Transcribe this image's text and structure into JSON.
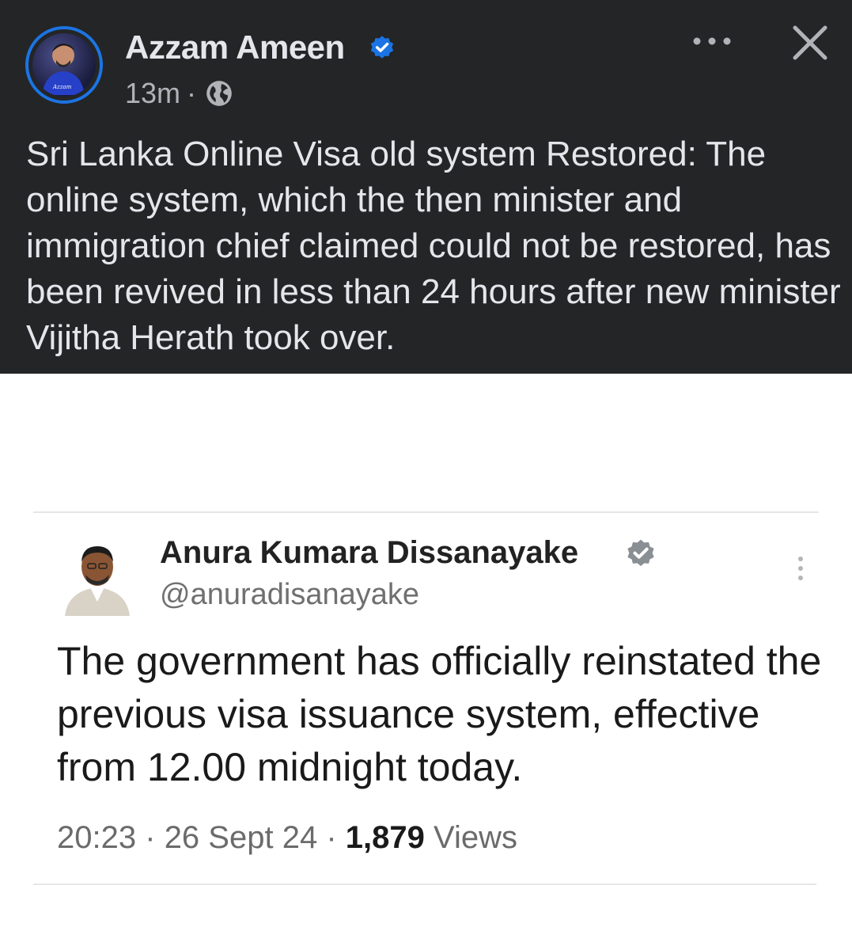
{
  "post": {
    "author": "Azzam Ameen",
    "time": "13m",
    "separator": "·",
    "text": "Sri Lanka Online Visa old system Restored: The online system, which the then minister and immigration chief claimed could not be restored, has been revived in less than 24 hours after new minister Vijitha Herath took over.",
    "icons": {
      "verified": "verified-badge-icon",
      "audience": "globe-icon",
      "more": "more-horizontal-icon",
      "close": "close-icon"
    },
    "colors": {
      "background": "#242526",
      "text": "#e4e6eb",
      "accent": "#1b74e4"
    }
  },
  "tweet": {
    "name": "Anura Kumara Dissanayake",
    "handle": "@anuradisanayake",
    "text": "The government has officially reinstated the previous visa issuance system, effective from 12.00 midnight today.",
    "time": "20:23",
    "date": "26 Sept 24",
    "separator": "·",
    "views_count": "1,879",
    "views_label": "Views",
    "icons": {
      "verified": "verified-badge-icon",
      "more": "more-vertical-icon"
    }
  }
}
